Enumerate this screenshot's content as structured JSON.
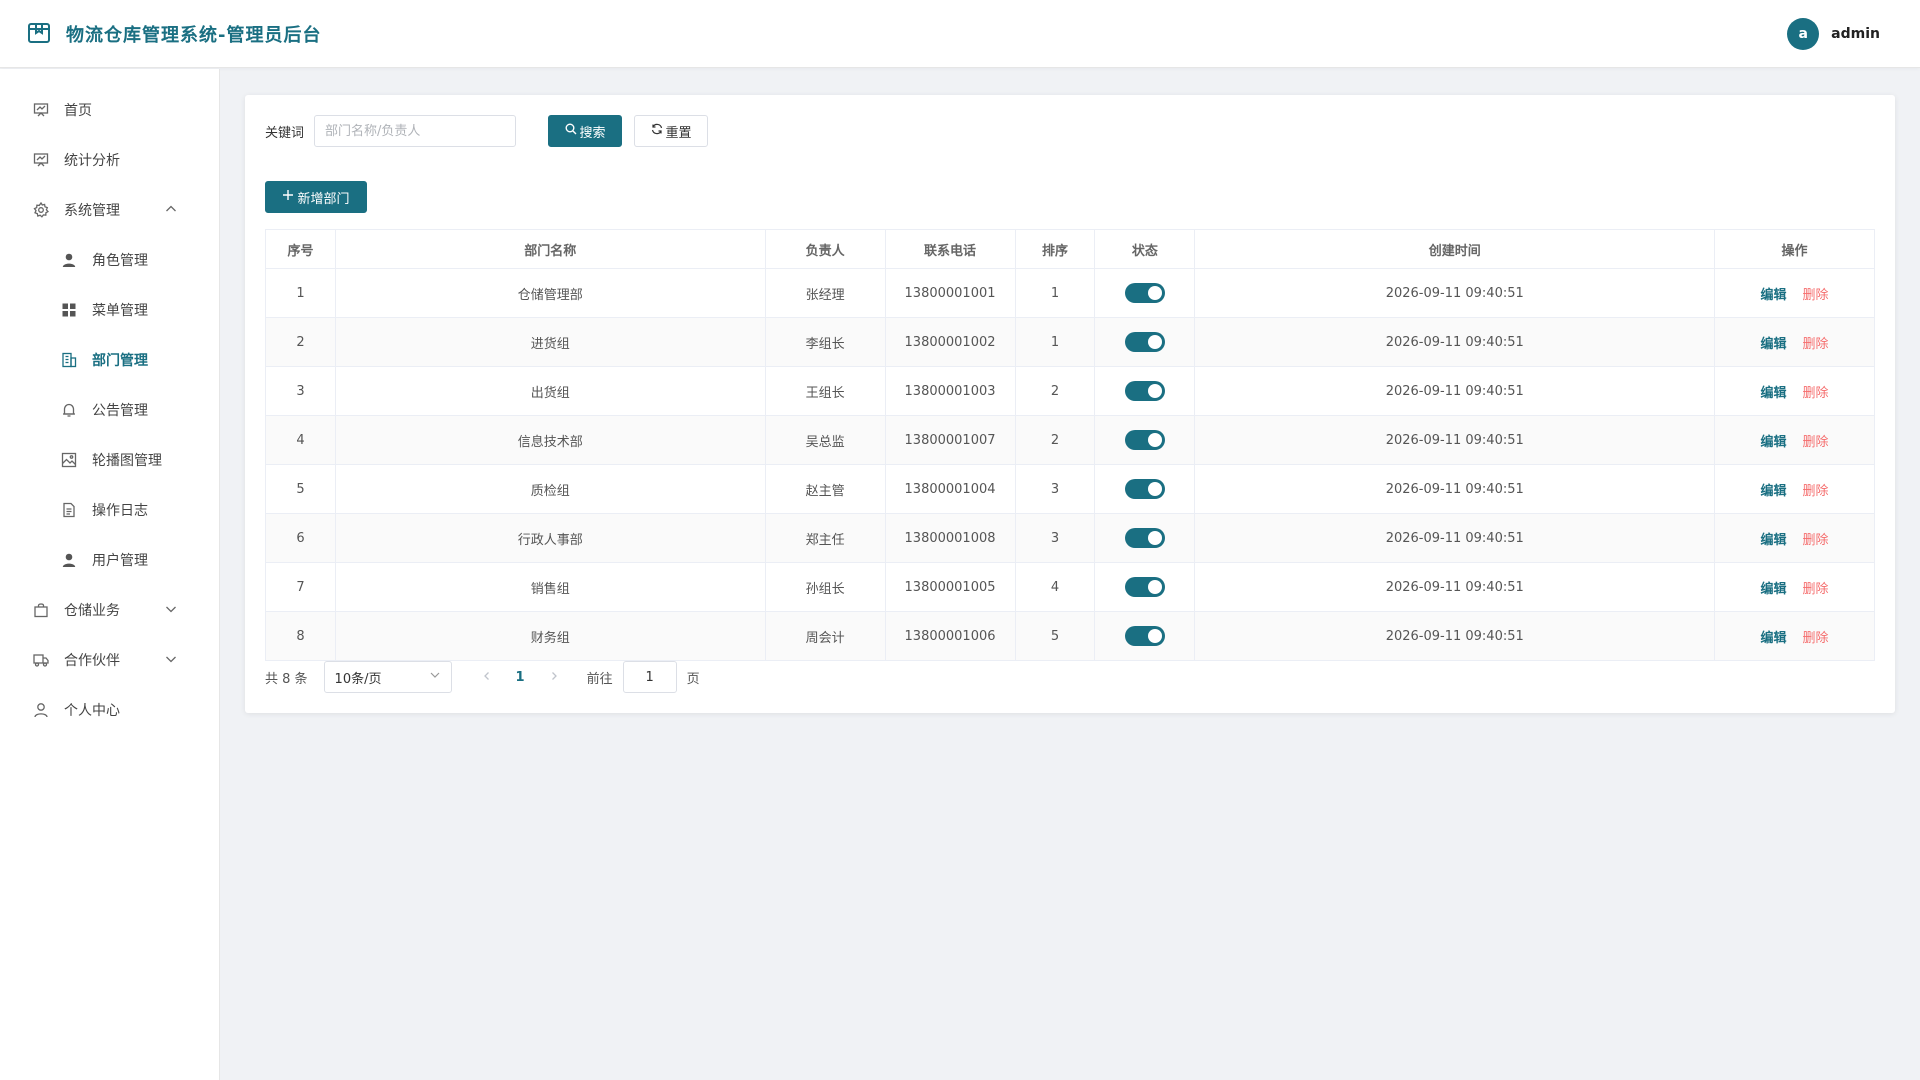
{
  "header": {
    "title": "物流仓库管理系统-管理员后台",
    "avatar_letter": "a",
    "username": "admin"
  },
  "sidebar": {
    "items": [
      {
        "label": "首页",
        "icon": "monitor-icon",
        "level": 0
      },
      {
        "label": "统计分析",
        "icon": "monitor-icon",
        "level": 0
      },
      {
        "label": "系统管理",
        "icon": "gear-icon",
        "level": 0,
        "expanded": true
      },
      {
        "label": "角色管理",
        "icon": "user-icon",
        "level": 1
      },
      {
        "label": "菜单管理",
        "icon": "grid-icon",
        "level": 1
      },
      {
        "label": "部门管理",
        "icon": "office-building-icon",
        "level": 1,
        "active": true
      },
      {
        "label": "公告管理",
        "icon": "bell-icon",
        "level": 1
      },
      {
        "label": "轮播图管理",
        "icon": "picture-icon",
        "level": 1
      },
      {
        "label": "操作日志",
        "icon": "document-icon",
        "level": 1
      },
      {
        "label": "用户管理",
        "icon": "user-icon",
        "level": 1
      },
      {
        "label": "仓储业务",
        "icon": "shopping-bag-icon",
        "level": 0,
        "expanded": false
      },
      {
        "label": "合作伙伴",
        "icon": "truck-icon",
        "level": 0,
        "expanded": false
      },
      {
        "label": "个人中心",
        "icon": "user-outline-icon",
        "level": 0
      }
    ]
  },
  "search": {
    "keyword_label": "关键词",
    "keyword_placeholder": "部门名称/负责人",
    "keyword_value": "",
    "search_label": "搜索",
    "reset_label": "重置",
    "add_label": "新增部门"
  },
  "table": {
    "columns": [
      "序号",
      "部门名称",
      "负责人",
      "联系电话",
      "排序",
      "状态",
      "创建时间",
      "操作"
    ],
    "rows": [
      {
        "index": "1",
        "name": "仓储管理部",
        "leader": "张经理",
        "phone": "13800001001",
        "sort": "1",
        "enabled": true,
        "created": "2026-09-11 09:40:51"
      },
      {
        "index": "2",
        "name": "进货组",
        "leader": "李组长",
        "phone": "13800001002",
        "sort": "1",
        "enabled": true,
        "created": "2026-09-11 09:40:51"
      },
      {
        "index": "3",
        "name": "出货组",
        "leader": "王组长",
        "phone": "13800001003",
        "sort": "2",
        "enabled": true,
        "created": "2026-09-11 09:40:51"
      },
      {
        "index": "4",
        "name": "信息技术部",
        "leader": "吴总监",
        "phone": "13800001007",
        "sort": "2",
        "enabled": true,
        "created": "2026-09-11 09:40:51"
      },
      {
        "index": "5",
        "name": "质检组",
        "leader": "赵主管",
        "phone": "13800001004",
        "sort": "3",
        "enabled": true,
        "created": "2026-09-11 09:40:51"
      },
      {
        "index": "6",
        "name": "行政人事部",
        "leader": "郑主任",
        "phone": "13800001008",
        "sort": "3",
        "enabled": true,
        "created": "2026-09-11 09:40:51"
      },
      {
        "index": "7",
        "name": "销售组",
        "leader": "孙组长",
        "phone": "13800001005",
        "sort": "4",
        "enabled": true,
        "created": "2026-09-11 09:40:51"
      },
      {
        "index": "8",
        "name": "财务组",
        "leader": "周会计",
        "phone": "13800001006",
        "sort": "5",
        "enabled": true,
        "created": "2026-09-11 09:40:51"
      }
    ],
    "edit_label": "编辑",
    "delete_label": "删除"
  },
  "pagination": {
    "total_text": "共 8 条",
    "page_size": "10条/页",
    "current_page": "1",
    "goto_label": "前往",
    "goto_value": "1",
    "page_suffix": "页"
  },
  "colors": {
    "primary": "#1a6f82",
    "danger": "#f56c6c"
  }
}
